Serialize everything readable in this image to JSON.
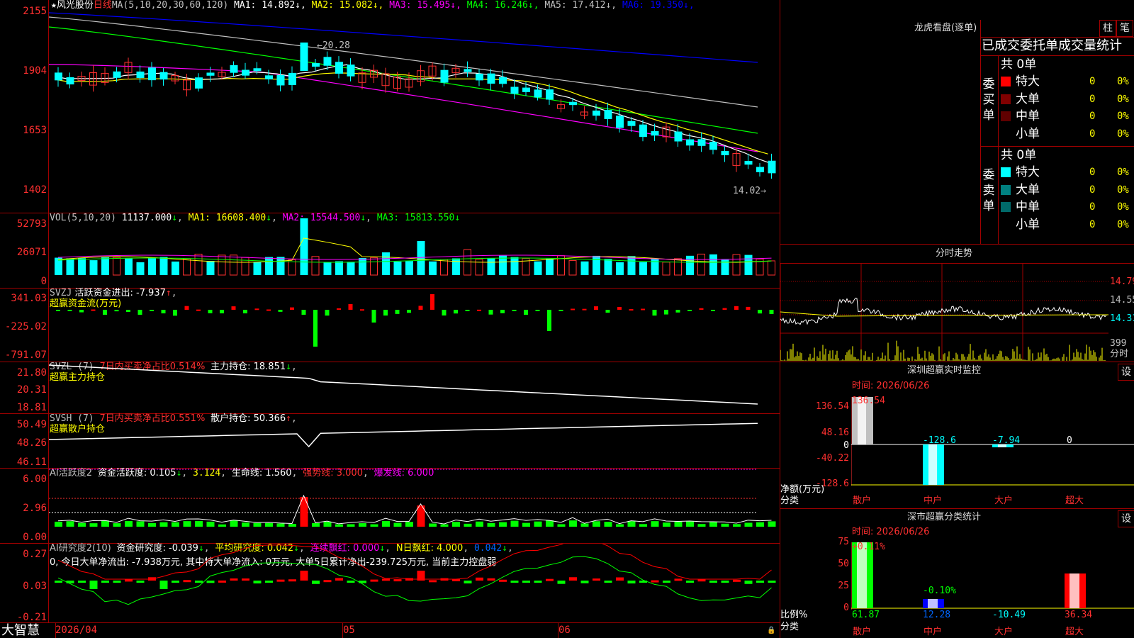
{
  "header": {
    "stock_name": "风光股份",
    "period": "日线",
    "ma_label": "MA(5,10,20,30,60,120)",
    "ma": [
      {
        "k": "MA1:",
        "v": "14.892",
        "color": "#ffffff"
      },
      {
        "k": "MA2:",
        "v": "15.082",
        "color": "#ffff00"
      },
      {
        "k": "MA3:",
        "v": "15.495",
        "color": "#ff00ff"
      },
      {
        "k": "MA4:",
        "v": "16.246",
        "color": "#00ff00"
      },
      {
        "k": "MA5:",
        "v": "17.412",
        "color": "#c0c0c0"
      },
      {
        "k": "MA6:",
        "v": "19.350",
        "color": "#0000ff"
      }
    ],
    "arrow": "↓"
  },
  "price_axis": [
    "2155",
    "1904",
    "1653",
    "1402"
  ],
  "price_annot": {
    "high": "20.28",
    "low": "14.02"
  },
  "vol": {
    "label": "VOL(5,10,20)",
    "value": "11137.000",
    "ma1": "MA1: 16608.400",
    "ma2": "MA2: 15544.500",
    "ma3": "MA3: 15813.550",
    "axis": [
      "52793",
      "26071",
      "0"
    ]
  },
  "svzj": {
    "label": "SVZJ",
    "text": " 活跃资金进出: -7.937",
    "arrow": "↑",
    "sub": "超赢资金流(万元)",
    "axis": [
      "341.03",
      "-225.02",
      "-791.07"
    ]
  },
  "svzl": {
    "label": "SVZL (7)",
    "pct": "7日内买卖净占比0.514%",
    "hold": "主力持仓: 18.851",
    "arrow": "↓",
    "sub": "超赢主力持仓",
    "axis": [
      "21.80",
      "20.31",
      "18.81"
    ]
  },
  "svsh": {
    "label": "SVSH (7)",
    "pct": "7日内买卖净占比0.551%",
    "hold": "散户持仓: 50.366",
    "arrow": "↑",
    "sub": "超赢散户持仓",
    "axis": [
      "50.49",
      "48.26",
      "46.11"
    ]
  },
  "ai1": {
    "label": "AI活跃度2",
    "a": "资金活跃度: 0.105",
    "b": "3.124",
    "c": "生命线: 1.560",
    "d": "强势线: 3.000",
    "e": "爆发线: 6.000",
    "axis": [
      "6.00",
      "2.96",
      "0.00"
    ]
  },
  "ai2": {
    "label": "AI研究度2(10)",
    "a": "资金研究度: -0.039",
    "b": "平均研究度: 0.042",
    "c": "连续飘红: 0.000",
    "d": "N日飘红: 4.000",
    "e": "0.042",
    "line2": "0, 今日大单净流出: -7.938万元, 其中特大单净流入: 0万元, 大单5日累计净出-239.725万元, 当前主力控盘弱",
    "axis": [
      "0.27",
      "0.03",
      "-0.21"
    ]
  },
  "date_axis": {
    "d1": "2026/04",
    "d2": "05",
    "d3": "06"
  },
  "brand": "大智慧",
  "right": {
    "lhb_title": "龙虎看盘(逐单)",
    "btn1": "柱",
    "btn2": "笔",
    "stat_title": "已成交委托单成交量统计",
    "buy": {
      "label": "委买单",
      "total": "共 0单",
      "rows": [
        {
          "name": "特大",
          "v": "0",
          "p": "0%",
          "color": "#ff0000"
        },
        {
          "name": "大单",
          "v": "0",
          "p": "0%",
          "color": "#800000"
        },
        {
          "name": "中单",
          "v": "0",
          "p": "0%",
          "color": "#600000"
        },
        {
          "name": "小单",
          "v": "0",
          "p": "0%",
          "color": "#000000"
        }
      ]
    },
    "sell": {
      "label": "委卖单",
      "total": "共 0单",
      "rows": [
        {
          "name": "特大",
          "v": "0",
          "p": "0%",
          "color": "#00ffff"
        },
        {
          "name": "大单",
          "v": "0",
          "p": "0%",
          "color": "#008080"
        },
        {
          "name": "中单",
          "v": "0",
          "p": "0%",
          "color": "#006a6a"
        },
        {
          "name": "小单",
          "v": "0",
          "p": "0%",
          "color": "#000000"
        }
      ]
    },
    "fs_title": "分时走势",
    "fs_axis": [
      "14.79",
      "14.55",
      "14.31",
      "399",
      "分时"
    ],
    "sz_title": "深圳超赢实时监控",
    "set1": "设",
    "sz_time": "时间: 2026/06/26",
    "sz_axis": [
      "136.54",
      "48.16",
      "0",
      "-40.22",
      "-128.6"
    ],
    "sz_vals": [
      "136.54",
      "-128.6",
      "-7.94",
      "0"
    ],
    "sz_unit": "净额(万元)",
    "sz_cat": "分类",
    "cats": [
      "散户",
      "中户",
      "大户",
      "超大"
    ],
    "sc_title": "深市超赢分类统计",
    "set2": "设",
    "sc_time": "时间: 2026/06/26",
    "sc_axis": [
      "75",
      "50",
      "25",
      "0"
    ],
    "sc_top": [
      "+0.11%",
      "-0.10%"
    ],
    "sc_vals": [
      "61.87",
      "12.28",
      "-10.49",
      "36.34"
    ],
    "sc_unit": "比例%",
    "sc_cat": "分类"
  }
}
